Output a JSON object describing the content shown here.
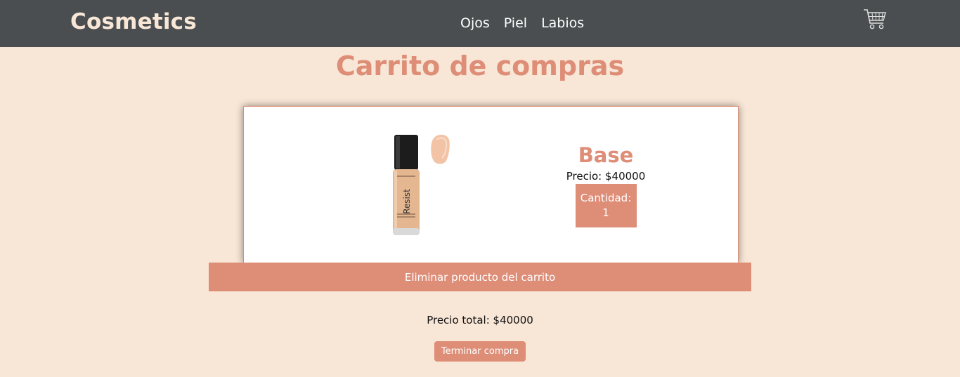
{
  "brand": "Cosmetics",
  "nav": {
    "items": [
      {
        "label": "Ojos"
      },
      {
        "label": "Piel"
      },
      {
        "label": "Labios"
      }
    ],
    "cart_icon": "shopping-cart-icon"
  },
  "page_title": "Carrito de compras",
  "cart": {
    "items": [
      {
        "name": "Base",
        "price_text": "Precio: $40000",
        "quantity_label": "Cantidad:",
        "quantity": "1",
        "image_icon": "foundation-bottle-image",
        "bottle_text": "Resist"
      }
    ],
    "remove_label": "Eliminar producto del carrito"
  },
  "total_text": "Precio total: $40000",
  "checkout_label": "Terminar compra",
  "colors": {
    "background": "#f8e6d6",
    "navbar": "#4a4e50",
    "accent": "#de8d77"
  }
}
